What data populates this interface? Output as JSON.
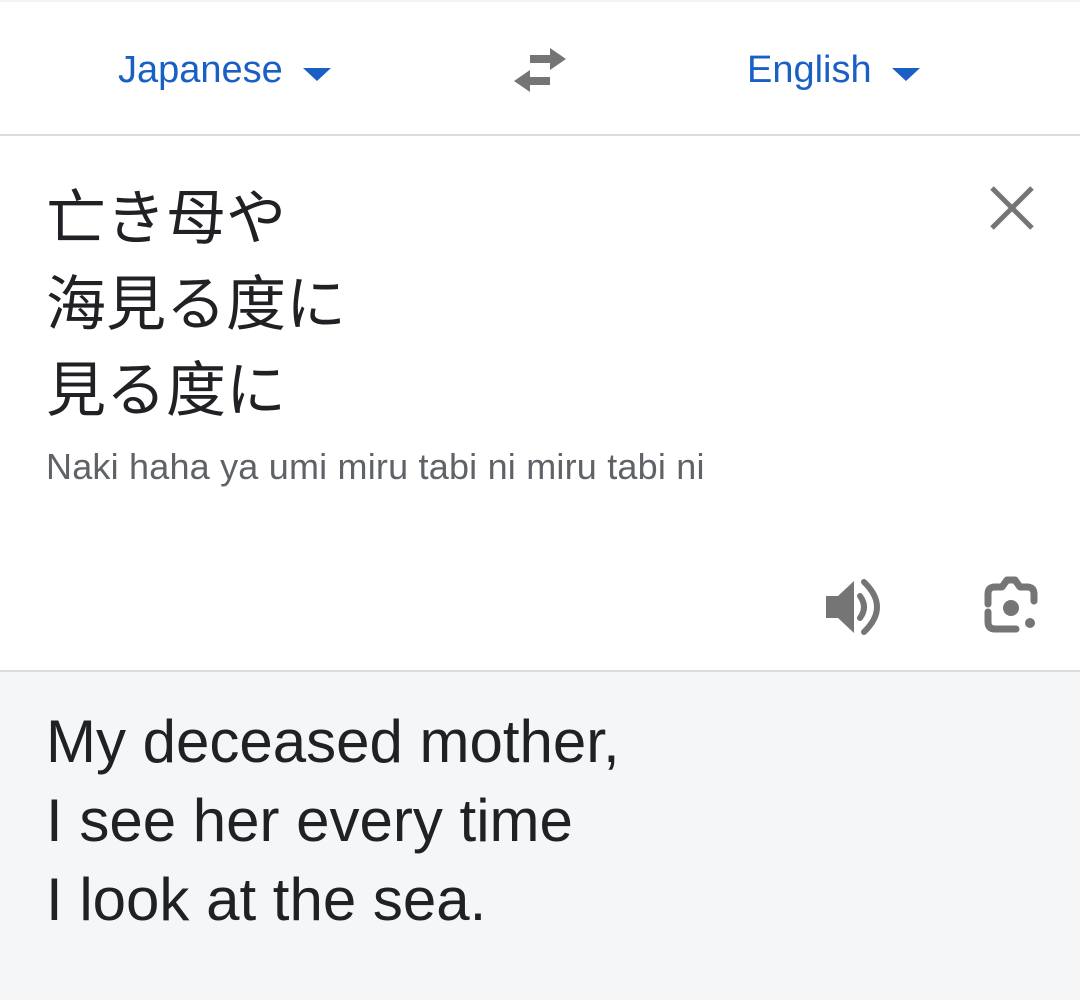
{
  "language_bar": {
    "source_language": "Japanese",
    "target_language": "English",
    "swap_icon": "swap-horiz-icon",
    "dropdown_icon": "caret-down-icon"
  },
  "source": {
    "lines": [
      "亡き母や",
      "海見る度に",
      "見る度に"
    ],
    "romanization": "Naki haha ya umi miru tabi ni miru tabi ni",
    "clear_icon": "close-icon",
    "listen_icon": "volume-up-icon",
    "camera_icon": "google-lens-icon"
  },
  "translation": {
    "lines": [
      "My deceased mother,",
      "I see her every time",
      "I look at the sea."
    ]
  },
  "colors": {
    "accent": "#1a5fc4",
    "icon": "#757575",
    "text": "#202124",
    "secondary_text": "#5f6368",
    "translation_background": "#f5f6f8",
    "divider": "#dadce0"
  }
}
